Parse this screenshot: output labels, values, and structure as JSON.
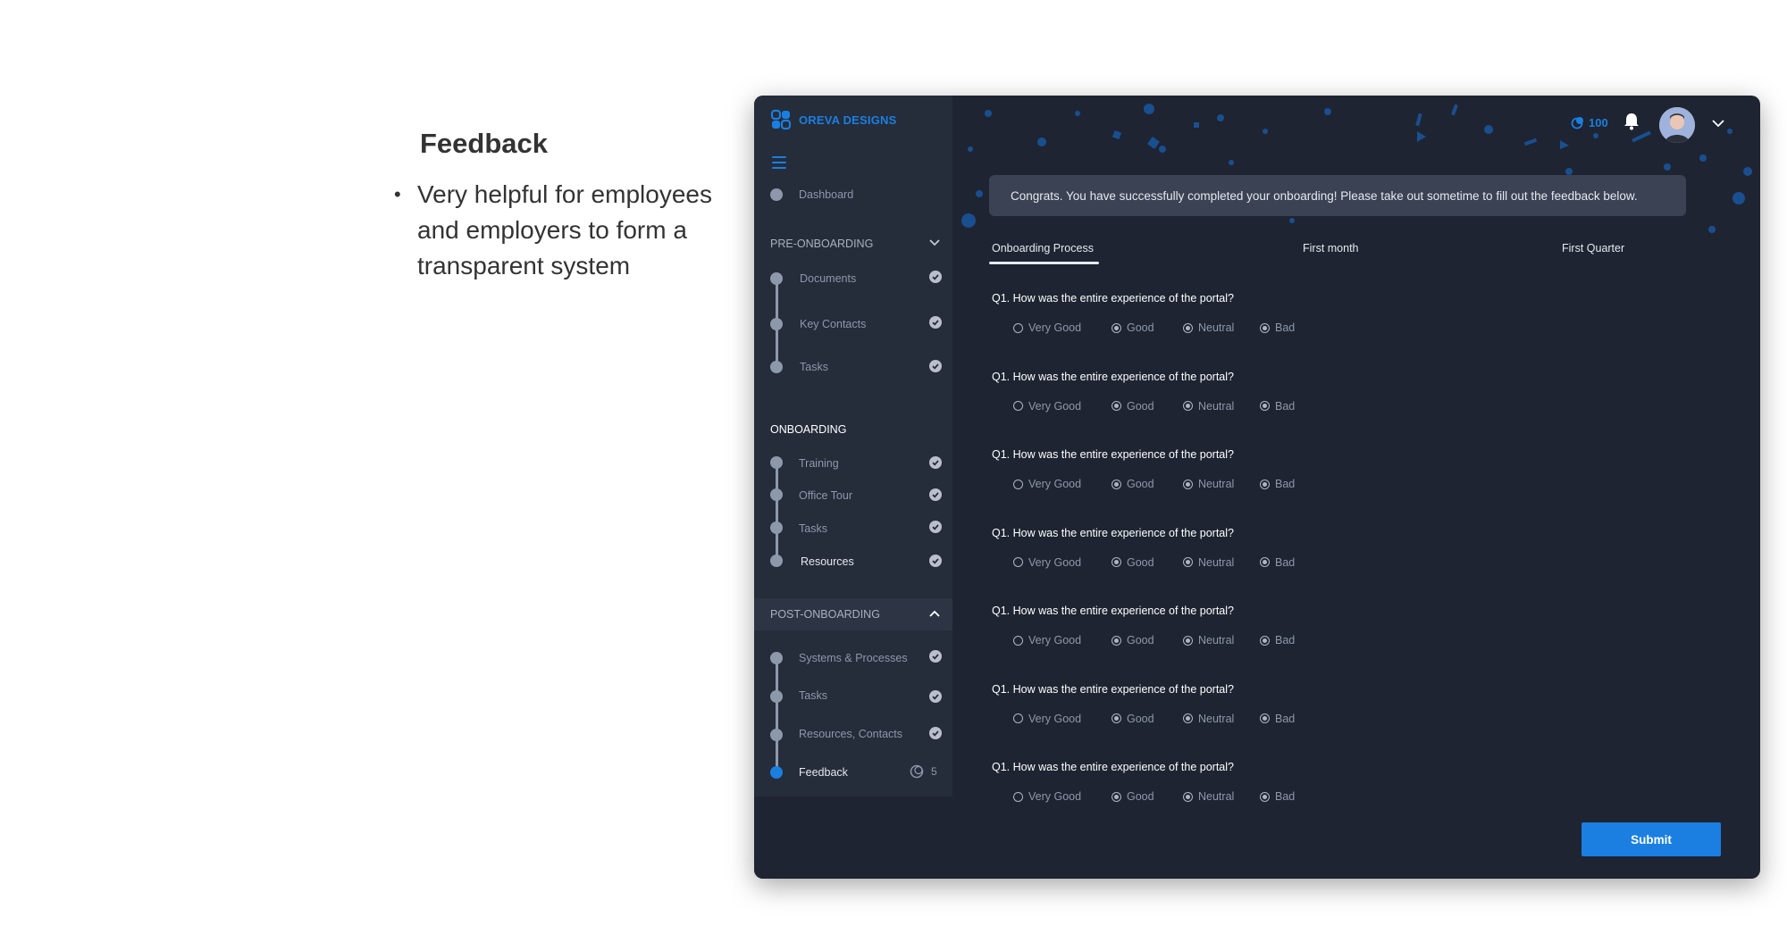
{
  "slide": {
    "title": "Feedback",
    "bullet": "Very helpful for employees and employers to form a transparent system"
  },
  "app": {
    "brand": "OREVA DESIGNS",
    "coins": "100",
    "colors": {
      "accent": "#1a7fe0",
      "window_bg": "#1e2431",
      "sidebar_bg": "#252c3a"
    }
  },
  "sidebar": {
    "dashboard": "Dashboard",
    "pre_onboarding": {
      "title": "PRE-ONBOARDING",
      "items": [
        "Documents",
        "Key Contacts",
        "Tasks"
      ]
    },
    "onboarding": {
      "title": "ONBOARDING",
      "items": [
        "Training",
        "Office Tour",
        "Tasks",
        "Resources"
      ]
    },
    "post_onboarding": {
      "title": "POST-ONBOARDING",
      "items": [
        "Systems & Processes",
        "Tasks",
        "Resources, Contacts",
        "Feedback"
      ],
      "feedback_count": "5"
    }
  },
  "main": {
    "banner": "Congrats. You have successfully completed your onboarding! Please take out sometime to fill out the feedback below.",
    "tabs": [
      "Onboarding Process",
      "First month",
      "First Quarter"
    ],
    "questions": [
      "Q1. How was the entire experience of the portal?",
      "Q1. How was the entire experience of the portal?",
      "Q1. How was the entire experience of the portal?",
      "Q1. How was the entire experience of the portal?",
      "Q1. How was the entire experience of the portal?",
      "Q1. How was the entire experience of the portal?",
      "Q1. How was the entire experience of the portal?"
    ],
    "options": [
      "Very Good",
      "Good",
      "Neutral",
      "Bad"
    ],
    "submit": "Submit"
  }
}
